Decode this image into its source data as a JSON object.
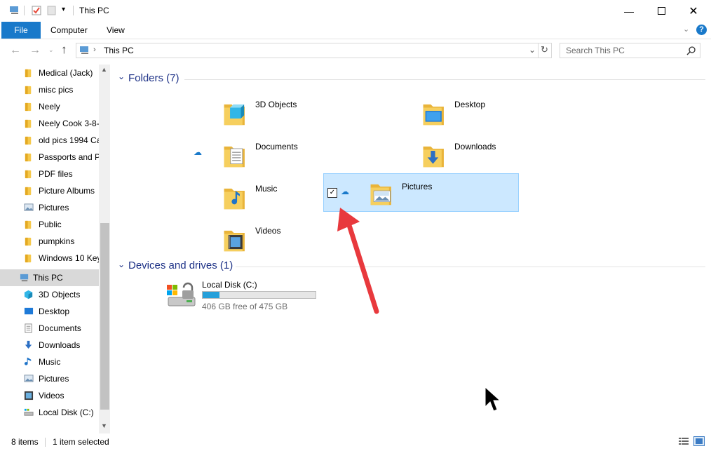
{
  "window": {
    "title": "This PC"
  },
  "ribbon": {
    "file": "File",
    "tabs": [
      "Computer",
      "View"
    ]
  },
  "address": {
    "path": "This PC",
    "search_placeholder": "Search This PC"
  },
  "nav": {
    "items": [
      {
        "label": "Medical (Jack)",
        "icon": "folder-icon"
      },
      {
        "label": "misc pics",
        "icon": "folder-icon"
      },
      {
        "label": "Neely",
        "icon": "folder-icon"
      },
      {
        "label": "Neely Cook 3-8-",
        "icon": "folder-icon"
      },
      {
        "label": "old pics 1994 Ca",
        "icon": "folder-icon"
      },
      {
        "label": "Passports and Pa",
        "icon": "folder-icon"
      },
      {
        "label": "PDF files",
        "icon": "folder-icon"
      },
      {
        "label": "Picture Albums",
        "icon": "folder-icon"
      },
      {
        "label": "Pictures",
        "icon": "pictures-icon"
      },
      {
        "label": "Public",
        "icon": "folder-icon"
      },
      {
        "label": "pumpkins",
        "icon": "folder-icon"
      },
      {
        "label": "Windows 10 Key",
        "icon": "folder-icon"
      },
      {
        "label": "This PC",
        "icon": "this-pc-icon"
      },
      {
        "label": "3D Objects",
        "icon": "3d-objects-icon"
      },
      {
        "label": "Desktop",
        "icon": "desktop-icon"
      },
      {
        "label": "Documents",
        "icon": "documents-icon"
      },
      {
        "label": "Downloads",
        "icon": "downloads-icon"
      },
      {
        "label": "Music",
        "icon": "music-icon"
      },
      {
        "label": "Pictures",
        "icon": "pictures-icon"
      },
      {
        "label": "Videos",
        "icon": "videos-icon"
      },
      {
        "label": "Local Disk (C:)",
        "icon": "drive-icon"
      }
    ]
  },
  "main": {
    "folders_header": "Folders (7)",
    "folders": [
      {
        "name": "3D Objects"
      },
      {
        "name": "Desktop"
      },
      {
        "name": "Documents"
      },
      {
        "name": "Downloads"
      },
      {
        "name": "Music"
      },
      {
        "name": "Pictures"
      },
      {
        "name": "Videos"
      }
    ],
    "devices_header": "Devices and drives (1)",
    "drive": {
      "name": "Local Disk (C:)",
      "free": "406 GB free of 475 GB",
      "used_fraction": 0.147
    }
  },
  "status": {
    "items": "8 items",
    "selected": "1 item selected"
  },
  "colors": {
    "accent": "#1979ca",
    "selection": "#cce8ff",
    "arrow": "#e8393d",
    "header": "#1e3287"
  }
}
